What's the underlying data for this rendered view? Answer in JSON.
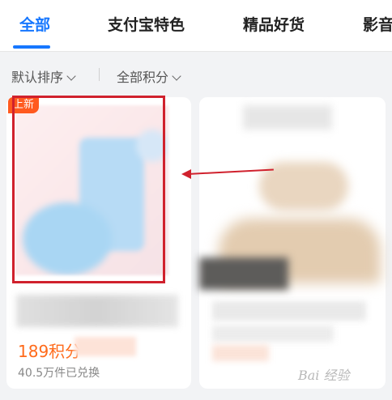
{
  "tabs": [
    {
      "label": "全部",
      "active": true
    },
    {
      "label": "支付宝特色",
      "active": false
    },
    {
      "label": "精品好货",
      "active": false
    },
    {
      "label": "影音",
      "active": false
    }
  ],
  "filters": {
    "sort_label": "默认排序",
    "points_label": "全部积分"
  },
  "products": [
    {
      "badge": "上新",
      "price": "189积分",
      "exchanged": "40.5万件已兑换"
    }
  ],
  "watermark": "Bai 经验",
  "colors": {
    "accent": "#1677ff",
    "price": "#ff6a1a",
    "annotation": "#d0212d",
    "badge": "#ff5a1f"
  }
}
